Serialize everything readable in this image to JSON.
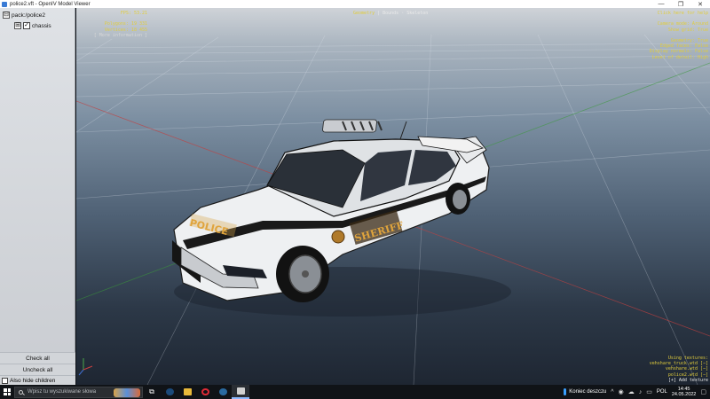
{
  "window": {
    "title": "police2.vft - OpenIV Model Viewer",
    "min_icon": "minimize-icon",
    "max_icon": "maximize-icon",
    "close_icon": "close-icon"
  },
  "sidebar": {
    "tree": [
      {
        "label": "pack:/police2",
        "expander": "⊟",
        "level": 0
      },
      {
        "label": "chassis",
        "expander": "⊞",
        "checked": true,
        "level": 1
      }
    ],
    "check_all": "Check all",
    "uncheck_all": "Uncheck all",
    "hide_children": "Also hide children"
  },
  "hud": {
    "fps": "FPS: 53.21",
    "polygons": "Polygons: 19 331",
    "vertices": "Vertices: 18 455",
    "more_info": "[ More information ]",
    "top_center_active": "Geometry",
    "top_center_rest": "| Bounds · Skeleton",
    "help": "Click here for help",
    "camera_mode": "Camera mode: Around",
    "show_grid": "Show grid: True",
    "geometry": "Geometry: True",
    "edged_faces": "Edged faces: False",
    "display_normals": "Display normals: False",
    "lod": "Level of detail: High",
    "using_textures": "Using textures:",
    "textures": [
      "vehshare_truck.wtd [−]",
      "vehshare.wtd [−]",
      "police2.wtd [−]"
    ],
    "add_texture": "[+] Add texture"
  },
  "car": {
    "hood_text": "POLICE",
    "door_text": "SHERIFF"
  },
  "taskbar": {
    "search_placeholder": "Wpisz tu wyszukiwane słowa",
    "weather": "Koniec deszczu",
    "language": "POL",
    "time": "14:45",
    "date": "24.05.2022",
    "apps": [
      "task-view-icon",
      "steam-icon",
      "file-explorer-icon",
      "opera-icon",
      "steam-icon",
      "openiv-icon"
    ]
  }
}
